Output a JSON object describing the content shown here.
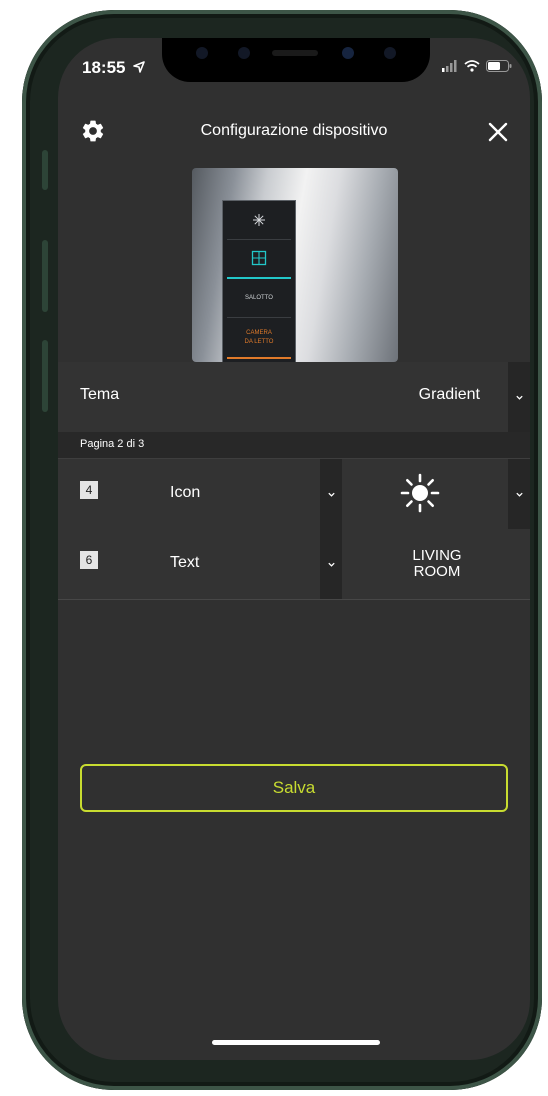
{
  "status_bar": {
    "time": "18:55",
    "icons": [
      "location-arrow-icon",
      "signal-icon",
      "wifi-icon",
      "battery-icon"
    ]
  },
  "header": {
    "title": "Configurazione dispositivo",
    "settings_icon": "gear-icon",
    "close_icon": "close-icon"
  },
  "preview": {
    "switch_labels": [
      "SALOTTO",
      "CAMERA",
      "DA LETTO"
    ],
    "accent_colors": {
      "teal": "#22c7c9",
      "orange": "#e07a2a"
    }
  },
  "theme": {
    "label": "Tema",
    "value": "Gradient"
  },
  "page_indicator": "Pagina 2 di 3",
  "buttons": [
    {
      "number": "4",
      "type": "Icon",
      "icon": "sun-icon"
    },
    {
      "number": "6",
      "type": "Text",
      "label": "LIVING\nROOM"
    }
  ],
  "save_label": "Salva",
  "colors": {
    "accent": "#c8dc30",
    "background": "#303030",
    "phone_frame": "#2d4437"
  }
}
